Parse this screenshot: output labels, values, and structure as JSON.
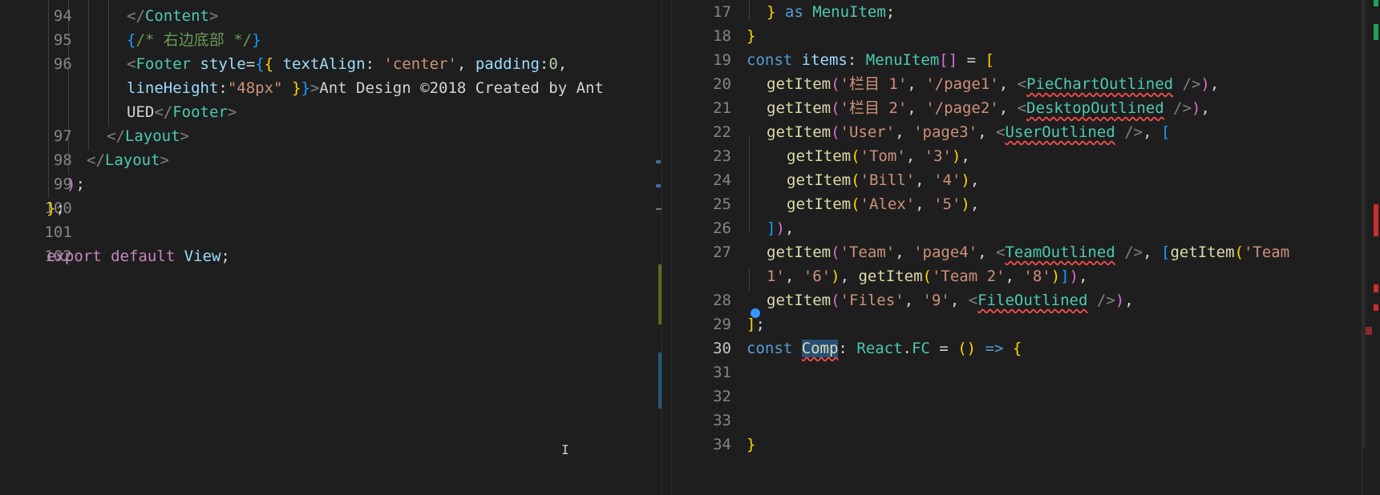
{
  "left_editor": {
    "lines": [
      {
        "num": "94",
        "html_key": "l94"
      },
      {
        "num": "95",
        "html_key": "l95"
      },
      {
        "num": "96",
        "html_key": "l96"
      },
      {
        "num": "",
        "html_key": "l96b"
      },
      {
        "num": "",
        "html_key": "l96c"
      },
      {
        "num": "97",
        "html_key": "l97"
      },
      {
        "num": "98",
        "html_key": "l98"
      },
      {
        "num": "99",
        "html_key": "l99"
      },
      {
        "num": "100",
        "html_key": "l100"
      },
      {
        "num": "101",
        "html_key": "l101"
      },
      {
        "num": "102",
        "html_key": "l102"
      }
    ],
    "text": {
      "close_content": "</Content>",
      "comment": "{/* 右边底部 */}",
      "footer_open": "<Footer style={{ textAlign: 'center', padding:0,",
      "footer_line2": "lineHeight:\"48px\" }}>Ant Design ©2018 Created by Ant",
      "footer_line3": "UED</Footer>",
      "close_layout_inner": "</Layout>",
      "close_layout_outer": "</Layout>",
      "close_paren": ");",
      "close_brace": "};",
      "export": "export default View;"
    }
  },
  "right_editor": {
    "active_line": "30",
    "line_numbers": [
      "17",
      "18",
      "19",
      "20",
      "21",
      "22",
      "23",
      "24",
      "25",
      "26",
      "27",
      "",
      "28",
      "29",
      "30",
      "31",
      "32",
      "33",
      "34"
    ],
    "text": {
      "l17": "} as MenuItem;",
      "l18": "}",
      "l19": "const items: MenuItem[] = [",
      "l20": "getItem('栏目 1', '/page1', <PieChartOutlined />),",
      "l21": "getItem('栏目 2', '/page2', <DesktopOutlined />),",
      "l22": "getItem('User', 'page3', <UserOutlined />, [",
      "l23": "getItem('Tom', '3'),",
      "l24": "getItem('Bill', '4'),",
      "l25": "getItem('Alex', '5'),",
      "l26": "]),",
      "l27": "getItem('Team', 'page4', <TeamOutlined />, [getItem('Team",
      "l27b": "1', '6'), getItem('Team 2', '8')]),",
      "l28": "getItem('Files', '9', <FileOutlined />),",
      "l29": "];",
      "l30": "const Comp: React.FC = () => {",
      "l34": "}"
    }
  },
  "colors": {
    "background": "#1e1e1e",
    "line_number": "#858585",
    "keyword": "#569cd6",
    "control": "#c586c0",
    "function": "#dcdcaa",
    "string": "#ce9178",
    "type": "#4ec9b0",
    "variable": "#9cdcfe",
    "error_squiggle": "#f14c4c",
    "selection": "#264f78"
  },
  "icons": {
    "lightbulb": "lightbulb-icon",
    "text_cursor": "text-cursor-icon"
  }
}
